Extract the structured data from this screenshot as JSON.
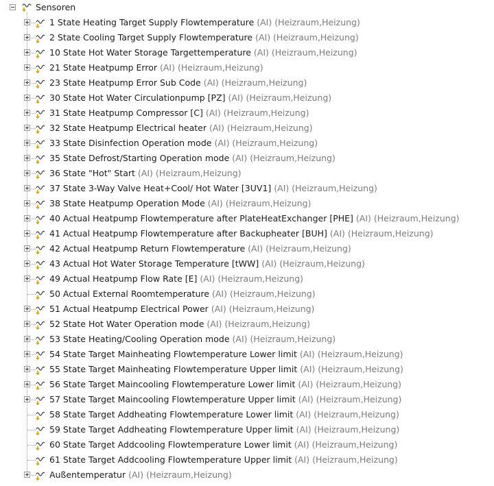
{
  "root": {
    "label": "Sensoren",
    "icon": "sensor-folder-icon"
  },
  "items": [
    {
      "name": "1 State Heating Target Supply Flowtemperature",
      "meta": "(AI) (Heizraum,Heizung)",
      "expandable": true
    },
    {
      "name": "2 State Cooling Target Supply Flowtemperature",
      "meta": "(AI) (Heizraum,Heizung)",
      "expandable": true
    },
    {
      "name": "10 State Hot Water Storage Targettemperature",
      "meta": "(AI) (Heizraum,Heizung)",
      "expandable": true
    },
    {
      "name": "21 State Heatpump Error",
      "meta": "(AI) (Heizraum,Heizung)",
      "expandable": true
    },
    {
      "name": "23 State Heatpump Error Sub Code",
      "meta": "(AI) (Heizraum,Heizung)",
      "expandable": true
    },
    {
      "name": "30 State Hot Water Circulationpump [PZ]",
      "meta": "(AI) (Heizraum,Heizung)",
      "expandable": true
    },
    {
      "name": "31 State Heatpump Compressor [C]",
      "meta": "(AI) (Heizraum,Heizung)",
      "expandable": true
    },
    {
      "name": "32 State Heatpump Electrical heater",
      "meta": "(AI) (Heizraum,Heizung)",
      "expandable": true
    },
    {
      "name": "33 State Disinfection Operation mode",
      "meta": "(AI) (Heizraum,Heizung)",
      "expandable": true
    },
    {
      "name": "35 State Defrost/Starting Operation mode",
      "meta": "(AI) (Heizraum,Heizung)",
      "expandable": true
    },
    {
      "name": "36 State \"Hot\" Start",
      "meta": "(AI) (Heizraum,Heizung)",
      "expandable": true
    },
    {
      "name": "37 State 3-Way Valve Heat+Cool/ Hot Water [3UV1]",
      "meta": "(AI) (Heizraum,Heizung)",
      "expandable": true
    },
    {
      "name": "38 State Heatpump Operation Mode",
      "meta": "(AI) (Heizraum,Heizung)",
      "expandable": true
    },
    {
      "name": "40 Actual Heatpump Flowtemperature after PlateHeatExchanger [PHE]",
      "meta": "(AI) (Heizraum,Heizung)",
      "expandable": true
    },
    {
      "name": "41 Actual Heatpump Flowtemperature after Backupheater [BUH]",
      "meta": "(AI) (Heizraum,Heizung)",
      "expandable": true
    },
    {
      "name": "42 Actual Heatpump Return Flowtemperature",
      "meta": "(AI) (Heizraum,Heizung)",
      "expandable": true
    },
    {
      "name": "43 Actual Hot Water Storage Temperature [tWW]",
      "meta": "(AI) (Heizraum,Heizung)",
      "expandable": true
    },
    {
      "name": "49 Actual Heatpump Flow Rate [E]",
      "meta": "(AI) (Heizraum,Heizung)",
      "expandable": true
    },
    {
      "name": "50 Actual External Roomtemperature",
      "meta": "(AI) (Heizraum,Heizung)",
      "expandable": false
    },
    {
      "name": "51 Actual Heatpump Electrical Power",
      "meta": "(AI) (Heizraum,Heizung)",
      "expandable": true
    },
    {
      "name": "52 State Hot Water Operation mode",
      "meta": "(AI) (Heizraum,Heizung)",
      "expandable": true
    },
    {
      "name": "53 State Heating/Cooling Operation mode",
      "meta": "(AI) (Heizraum,Heizung)",
      "expandable": true
    },
    {
      "name": "54 State Target Mainheating Flowtemperature Lower limit",
      "meta": "(AI) (Heizraum,Heizung)",
      "expandable": true
    },
    {
      "name": "55 State Target Mainheating Flowtemperature Upper limit",
      "meta": "(AI) (Heizraum,Heizung)",
      "expandable": true
    },
    {
      "name": "56 State Target Maincooling Flowtemperature Lower limit",
      "meta": "(AI) (Heizraum,Heizung)",
      "expandable": true
    },
    {
      "name": "57 State Target Maincooling Flowtemperature Upper limit",
      "meta": "(AI) (Heizraum,Heizung)",
      "expandable": true
    },
    {
      "name": "58 State Target Addheating Flowtemperature Lower limit",
      "meta": "(AI) (Heizraum,Heizung)",
      "expandable": false
    },
    {
      "name": "59 State Target Addheating Flowtemperature Upper limit",
      "meta": "(AI) (Heizraum,Heizung)",
      "expandable": false
    },
    {
      "name": "60 State Target Addcooling Flowtemperature Lower limit",
      "meta": "(AI) (Heizraum,Heizung)",
      "expandable": false
    },
    {
      "name": "61 State Target Addcooling Flowtemperature Upper limit",
      "meta": "(AI) (Heizraum,Heizung)",
      "expandable": false
    },
    {
      "name": "Außentemperatur",
      "meta": "(AI) (Heizraum,Heizung)",
      "expandable": true
    }
  ],
  "colors": {
    "meta_text": "#7a7a7a",
    "icon_wave": "#444444",
    "icon_arrow": "#e0a100",
    "tree_lines": "#a0a0a0"
  }
}
